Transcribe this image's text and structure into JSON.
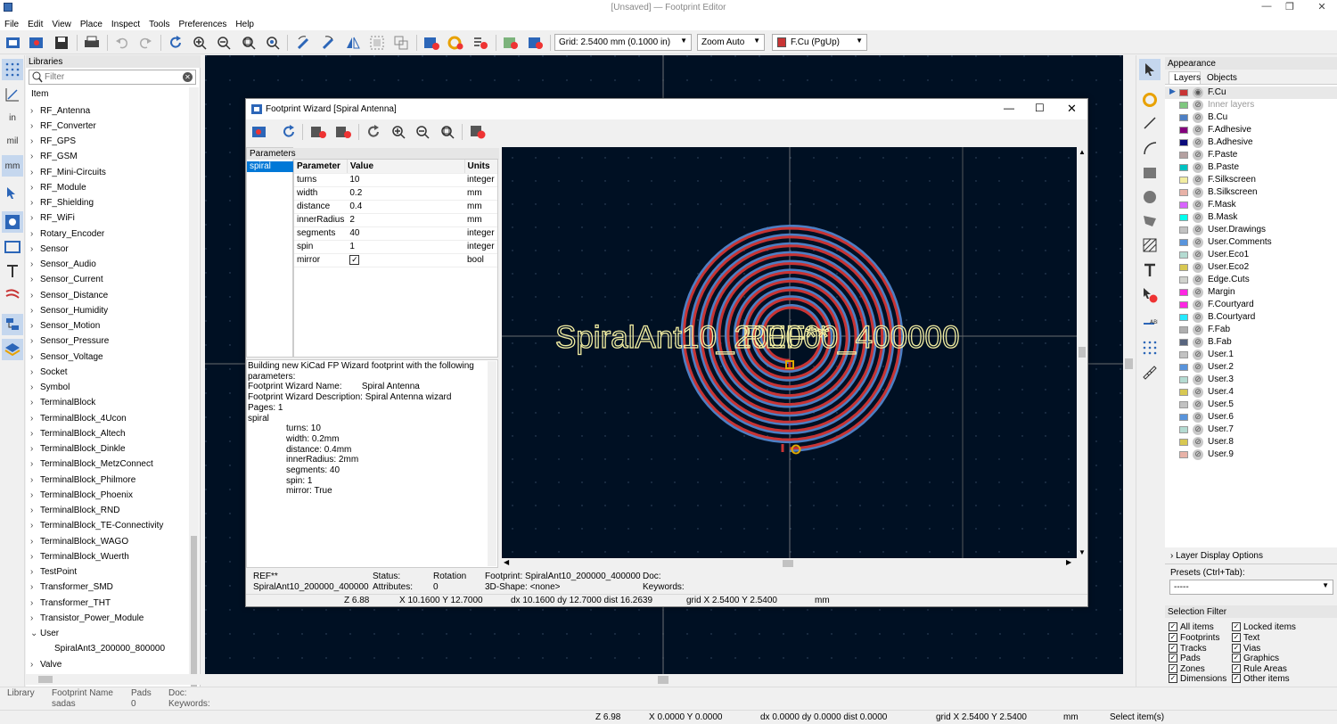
{
  "window": {
    "title": "[Unsaved] — Footprint Editor",
    "controls": {
      "minimize": "—",
      "maximize": "❐",
      "close": "✕"
    }
  },
  "menu": [
    "File",
    "Edit",
    "View",
    "Place",
    "Inspect",
    "Tools",
    "Preferences",
    "Help"
  ],
  "toolbar": {
    "grid": "Grid: 2.5400 mm (0.1000 in)",
    "zoom": "Zoom Auto",
    "layer": "F.Cu (PgUp)",
    "layer_color": "#c83434"
  },
  "left_toolbar": {
    "inch_label": "in",
    "mil_label": "mil",
    "mm_label": "mm"
  },
  "libraries": {
    "header": "Libraries",
    "filter_placeholder": "Filter",
    "column": "Item",
    "items": [
      "RF_Antenna",
      "RF_Converter",
      "RF_GPS",
      "RF_GSM",
      "RF_Mini-Circuits",
      "RF_Module",
      "RF_Shielding",
      "RF_WiFi",
      "Rotary_Encoder",
      "Sensor",
      "Sensor_Audio",
      "Sensor_Current",
      "Sensor_Distance",
      "Sensor_Humidity",
      "Sensor_Motion",
      "Sensor_Pressure",
      "Sensor_Voltage",
      "Socket",
      "Symbol",
      "TerminalBlock",
      "TerminalBlock_4Ucon",
      "TerminalBlock_Altech",
      "TerminalBlock_Dinkle",
      "TerminalBlock_MetzConnect",
      "TerminalBlock_Philmore",
      "TerminalBlock_Phoenix",
      "TerminalBlock_RND",
      "TerminalBlock_TE-Connectivity",
      "TerminalBlock_WAGO",
      "TerminalBlock_Wuerth",
      "TestPoint",
      "Transformer_SMD",
      "Transformer_THT",
      "Transistor_Power_Module",
      "User"
    ],
    "user_child": "SpiralAnt3_200000_800000",
    "last_item": "Valve",
    "tree_collapsed": "›",
    "tree_expanded": "⌄"
  },
  "dialog": {
    "title": "Footprint Wizard [Spiral Antenna]",
    "pages_header": "Parameters",
    "page": "spiral",
    "columns": [
      "Parameter",
      "Value",
      "Units"
    ],
    "params": [
      {
        "name": "turns",
        "value": "10",
        "units": "integer"
      },
      {
        "name": "width",
        "value": "0.2",
        "units": "mm"
      },
      {
        "name": "distance",
        "value": "0.4",
        "units": "mm"
      },
      {
        "name": "innerRadius",
        "value": "2",
        "units": "mm"
      },
      {
        "name": "segments",
        "value": "40",
        "units": "integer"
      },
      {
        "name": "spin",
        "value": "1",
        "units": "integer"
      },
      {
        "name": "mirror",
        "value": "",
        "units": "bool",
        "checked": true
      }
    ],
    "checkmark": "✓",
    "messages": [
      "Building new KiCad FP Wizard footprint with the following",
      "parameters:",
      "Footprint Wizard Name:        Spiral Antenna",
      "Footprint Wizard Description: Spiral Antenna wizard",
      "Pages: 1",
      "spiral",
      "turns: 10",
      "width: 0.2mm",
      "distance: 0.4mm",
      "innerRadius: 2mm",
      "segments: 40",
      "spin: 1",
      "mirror: True"
    ],
    "preview_ref": "REF**",
    "preview_value": "SpiralAnt10_200000_400000",
    "info": {
      "ref": "REF**",
      "value": "SpiralAnt10_200000_400000",
      "status_label": "Status:",
      "attributes_label": "Attributes:",
      "rotation_label": "Rotation",
      "rotation": "0",
      "footprint": "Footprint: SpiralAnt10_200000_400000",
      "shape": "3D-Shape: <none>",
      "doc": "Doc:",
      "keywords": "Keywords:"
    },
    "status": {
      "z": "Z 6.88",
      "xy": "X 10.1600  Y 12.7000",
      "dxy": "dx 10.1600  dy 12.7000  dist 16.2639",
      "grid": "grid X 2.5400  Y 2.5400",
      "units": "mm"
    }
  },
  "appearance": {
    "header": "Appearance",
    "tabs": [
      "Layers",
      "Objects"
    ],
    "layers": [
      {
        "name": "F.Cu",
        "color": "#c83434",
        "active": true
      },
      {
        "name": "Inner layers",
        "color": "#7fc87f",
        "dim": true
      },
      {
        "name": "B.Cu",
        "color": "#4d7fc4"
      },
      {
        "name": "F.Adhesive",
        "color": "#84007c"
      },
      {
        "name": "B.Adhesive",
        "color": "#0a0a7a"
      },
      {
        "name": "F.Paste",
        "color": "#b4a0a0"
      },
      {
        "name": "B.Paste",
        "color": "#00c2c2"
      },
      {
        "name": "F.Silkscreen",
        "color": "#f2eda1"
      },
      {
        "name": "B.Silkscreen",
        "color": "#e8b2a7"
      },
      {
        "name": "F.Mask",
        "color": "#d864ff"
      },
      {
        "name": "B.Mask",
        "color": "#02ffee"
      },
      {
        "name": "User.Drawings",
        "color": "#c2c2c2"
      },
      {
        "name": "User.Comments",
        "color": "#5994dc"
      },
      {
        "name": "User.Eco1",
        "color": "#b4dbd2"
      },
      {
        "name": "User.Eco2",
        "color": "#d8c852"
      },
      {
        "name": "Edge.Cuts",
        "color": "#d0d2cd"
      },
      {
        "name": "Margin",
        "color": "#ff26e2"
      },
      {
        "name": "F.Courtyard",
        "color": "#ff26e2"
      },
      {
        "name": "B.Courtyard",
        "color": "#26e9ff"
      },
      {
        "name": "F.Fab",
        "color": "#afafaf"
      },
      {
        "name": "B.Fab",
        "color": "#58657e"
      },
      {
        "name": "User.1",
        "color": "#c2c2c2"
      },
      {
        "name": "User.2",
        "color": "#5994dc"
      },
      {
        "name": "User.3",
        "color": "#b4dbd2"
      },
      {
        "name": "User.4",
        "color": "#d8c852"
      },
      {
        "name": "User.5",
        "color": "#c2c2c2"
      },
      {
        "name": "User.6",
        "color": "#5994dc"
      },
      {
        "name": "User.7",
        "color": "#b4dbd2"
      },
      {
        "name": "User.8",
        "color": "#d8c852"
      },
      {
        "name": "User.9",
        "color": "#e8b2a7"
      }
    ],
    "layer_display_options": "Layer Display Options",
    "presets_label": "Presets (Ctrl+Tab):",
    "presets_value": "-----"
  },
  "selection_filter": {
    "header": "Selection Filter",
    "left": [
      "All items",
      "Footprints",
      "Tracks",
      "Pads",
      "Zones",
      "Dimensions"
    ],
    "right": [
      "Locked items",
      "Text",
      "Vias",
      "Graphics",
      "Rule Areas",
      "Other items"
    ]
  },
  "footprint_info": {
    "library_label": "Library",
    "name_label": "Footprint Name",
    "name": "sadas",
    "pads_label": "Pads",
    "pads": "0",
    "doc_label": "Doc:",
    "keywords_label": "Keywords:"
  },
  "statusbar": {
    "z": "Z 6.98",
    "xy": "X 0.0000  Y 0.0000",
    "dxy": "dx 0.0000  dy 0.0000  dist 0.0000",
    "grid": "grid X 2.5400  Y 2.5400",
    "units": "mm",
    "mode": "Select item(s)"
  },
  "colors": {
    "canvas_bg": "#001023",
    "silk": "#f2eda1",
    "front_copper": "#c83434",
    "back_copper": "#4d7fc4",
    "pad": "#e0a800"
  }
}
